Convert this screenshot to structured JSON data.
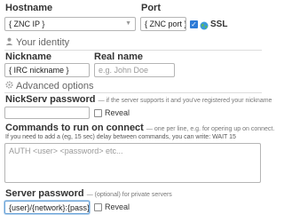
{
  "connection": {
    "hostname_label": "Hostname",
    "hostname_value": "{ ZNC IP }",
    "port_label": "Port",
    "port_value": "{ ZNC port }",
    "ssl_label": "SSL",
    "ssl_checked": true
  },
  "identity": {
    "section_title": "Your identity",
    "nickname_label": "Nickname",
    "nickname_value": "{ IRC nickname }",
    "realname_label": "Real name",
    "realname_placeholder": "e.g. John Doe"
  },
  "advanced": {
    "section_title": "Advanced options",
    "nickserv_label": "NickServ password",
    "nickserv_hint": "— if the server supports it and you've registered your nickname",
    "nickserv_reveal": "Reveal",
    "commands_label": "Commands to run on connect",
    "commands_hint": "— one per line, e.g. for opering up on connect.",
    "commands_hint2": "If you need to add a (eg, 15 sec) delay between commands, you can write: WAIT 15",
    "commands_placeholder": "AUTH <user> <password> etc...",
    "server_password_label": "Server password",
    "server_password_hint": "— (optional) for private servers",
    "server_password_value": "{user}/{network}:{pass}",
    "server_password_reveal": "Reveal"
  },
  "icons": {
    "ssl": "ssl-globe-icon",
    "identity": "user-icon",
    "advanced": "gear-icon"
  },
  "colors": {
    "accent": "#2d7bd6",
    "focus": "#6aa3d8"
  }
}
